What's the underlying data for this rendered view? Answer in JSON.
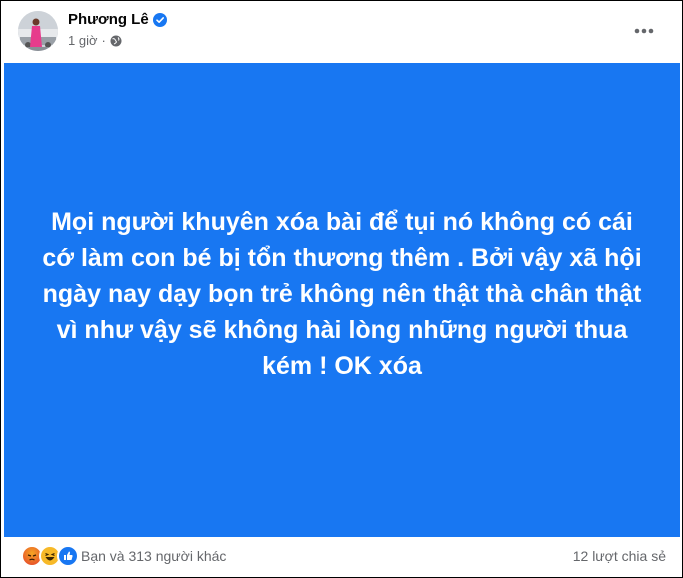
{
  "post": {
    "author": "Phương Lê",
    "time": "1 giờ",
    "separator": "·",
    "text": "Mọi người khuyên xóa bài để tụi nó không có cái cớ làm con bé bị tổn thương thêm . Bởi vậy xã hội ngày nay dạy bọn trẻ không nên thật thà chân thật vì như vậy sẽ không hài lòng những người thua kém ! OK xóa",
    "background_color": "#1877f2"
  },
  "footer": {
    "reactions": [
      "angry",
      "haha",
      "like"
    ],
    "reaction_text": "Bạn và 313 người khác",
    "shares": "12 lượt chia sẻ"
  },
  "icons": {
    "verified": "verified-badge-icon",
    "audience": "globe-icon",
    "more": "more-options-icon"
  }
}
